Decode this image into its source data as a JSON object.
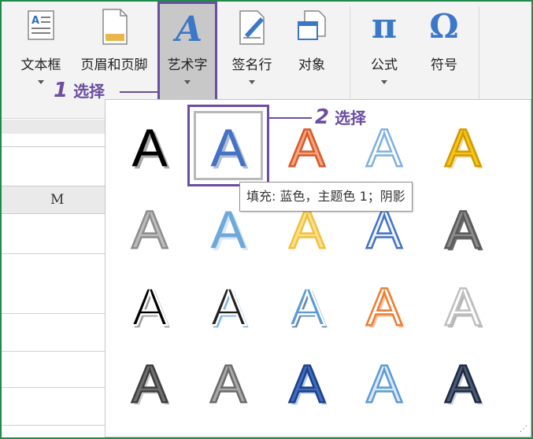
{
  "ribbon": {
    "items": [
      {
        "label": "文本框",
        "icon": "textbox-icon"
      },
      {
        "label": "页眉和页脚",
        "icon": "header-footer-icon"
      },
      {
        "label": "艺术字",
        "icon": "wordart-icon"
      },
      {
        "label": "签名行",
        "icon": "signature-line-icon"
      },
      {
        "label": "对象",
        "icon": "object-icon"
      },
      {
        "label": "公式",
        "icon": "equation-icon",
        "glyph": "π"
      },
      {
        "label": "符号",
        "icon": "symbol-icon",
        "glyph": "Ω"
      }
    ]
  },
  "callouts": {
    "step1_num": "1",
    "step1_text": "选择",
    "step2_num": "2",
    "step2_text": "选择"
  },
  "sheet": {
    "column_header": "M"
  },
  "gallery": {
    "glyph": "A",
    "selected_index": 1,
    "tooltip": "填充: 蓝色，主题色 1；阴影",
    "styles": [
      {
        "fill": "#000000",
        "stroke": "none",
        "shadow": "#8a8a8a"
      },
      {
        "fill": "#4472c4",
        "stroke": "none",
        "shadow": "#9aa9c8"
      },
      {
        "fill": "#f6a67e",
        "stroke": "#d9582b",
        "shadow": "none"
      },
      {
        "fill": "#ffffff",
        "stroke": "#7eb0e0",
        "shadow": "none"
      },
      {
        "fill": "#f5c518",
        "stroke": "#d39a00",
        "shadow": "#e6d38a"
      },
      {
        "fill": "#bdbdbd",
        "stroke": "#8d8d8d",
        "shadow": "none"
      },
      {
        "fill": "#6fa8dc",
        "stroke": "none",
        "shadow": "#cfe2f3"
      },
      {
        "fill": "#ffe08a",
        "stroke": "#f0c040",
        "shadow": "none"
      },
      {
        "fill": "#eef4fb",
        "stroke": "#4472c4",
        "shadow": "none"
      },
      {
        "fill": "#8c8c8c",
        "stroke": "#5a5a5a",
        "shadow": "#3a3a3a"
      },
      {
        "fill": "#000000",
        "stroke": "#ffffff",
        "shadow": "#7a7a7a"
      },
      {
        "fill": "#222222",
        "stroke": "#ffffff",
        "shadow": "#5b9bd5"
      },
      {
        "fill": "#5b9bd5",
        "stroke": "#ffffff",
        "shadow": "#2e5f95"
      },
      {
        "fill": "#ffffff",
        "stroke": "#ed7d31",
        "shadow": "#f4b183"
      },
      {
        "fill": "#ffffff",
        "stroke": "#bfbfbf",
        "shadow": "#9e9e9e"
      },
      {
        "fill": "#707070",
        "stroke": "#3f3f3f",
        "shadow": "#bbbbbb"
      },
      {
        "fill": "#aaaaaa",
        "stroke": "#6a6a6a",
        "shadow": "none"
      },
      {
        "fill": "#3c6fc2",
        "stroke": "#1f3f86",
        "shadow": "#9bb7e6"
      },
      {
        "fill": "#dbe8f7",
        "stroke": "#5b9bd5",
        "shadow": "none"
      },
      {
        "fill": "#4a5a78",
        "stroke": "#1f2a3e",
        "shadow": "#b6c2d6"
      }
    ]
  }
}
